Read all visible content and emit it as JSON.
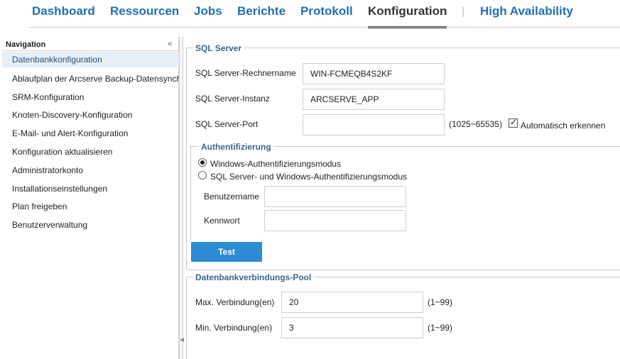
{
  "topnav": {
    "tabs": [
      {
        "label": "Dashboard"
      },
      {
        "label": "Ressourcen"
      },
      {
        "label": "Jobs"
      },
      {
        "label": "Berichte"
      },
      {
        "label": "Protokoll"
      },
      {
        "label": "Konfiguration"
      },
      {
        "label": "High Availability"
      }
    ],
    "active": "Konfiguration",
    "separator": "|"
  },
  "sidebar": {
    "title": "Navigation",
    "collapse_icon": "double-chevron-left-icon",
    "items": [
      {
        "label": "Datenbankkonfiguration"
      },
      {
        "label": "Ablaufplan der Arcserve Backup-Datensynchronisierung"
      },
      {
        "label": "SRM-Konfiguration"
      },
      {
        "label": "Knoten-Discovery-Konfiguration"
      },
      {
        "label": "E-Mail- und Alert-Konfiguration"
      },
      {
        "label": "Konfiguration aktualisieren"
      },
      {
        "label": "Administratorkonto"
      },
      {
        "label": "Installationseinstellungen"
      },
      {
        "label": "Plan freigeben"
      },
      {
        "label": "Benutzerverwaltung"
      }
    ],
    "selected": "Datenbankkonfiguration"
  },
  "sql_server": {
    "legend": "SQL Server",
    "host_label": "SQL Server-Rechnername",
    "host_value": "WIN-FCMEQB4S2KF",
    "instance_label": "SQL Server-Instanz",
    "instance_value": "ARCSERVE_APP",
    "port_label": "SQL Server-Port",
    "port_value": "",
    "port_range": "(1025~65535)",
    "auto_detect_label": "Automatisch erkennen",
    "auto_detect_checked": true
  },
  "auth": {
    "legend": "Authentifizierung",
    "option_windows": "Windows-Authentifizierungsmodus",
    "option_mixed": "SQL Server- und Windows-Authentifizierungsmodus",
    "selected": "windows",
    "username_label": "Benutzername",
    "username_value": "",
    "password_label": "Kennwort",
    "password_value": "",
    "test_button": "Test"
  },
  "pool": {
    "legend": "Datenbankverbindungs-Pool",
    "max_label": "Max. Verbindung(en)",
    "max_value": "20",
    "max_range": "(1~99)",
    "min_label": "Min. Verbindung(en)",
    "min_value": "3",
    "min_range": "(1~99)"
  }
}
